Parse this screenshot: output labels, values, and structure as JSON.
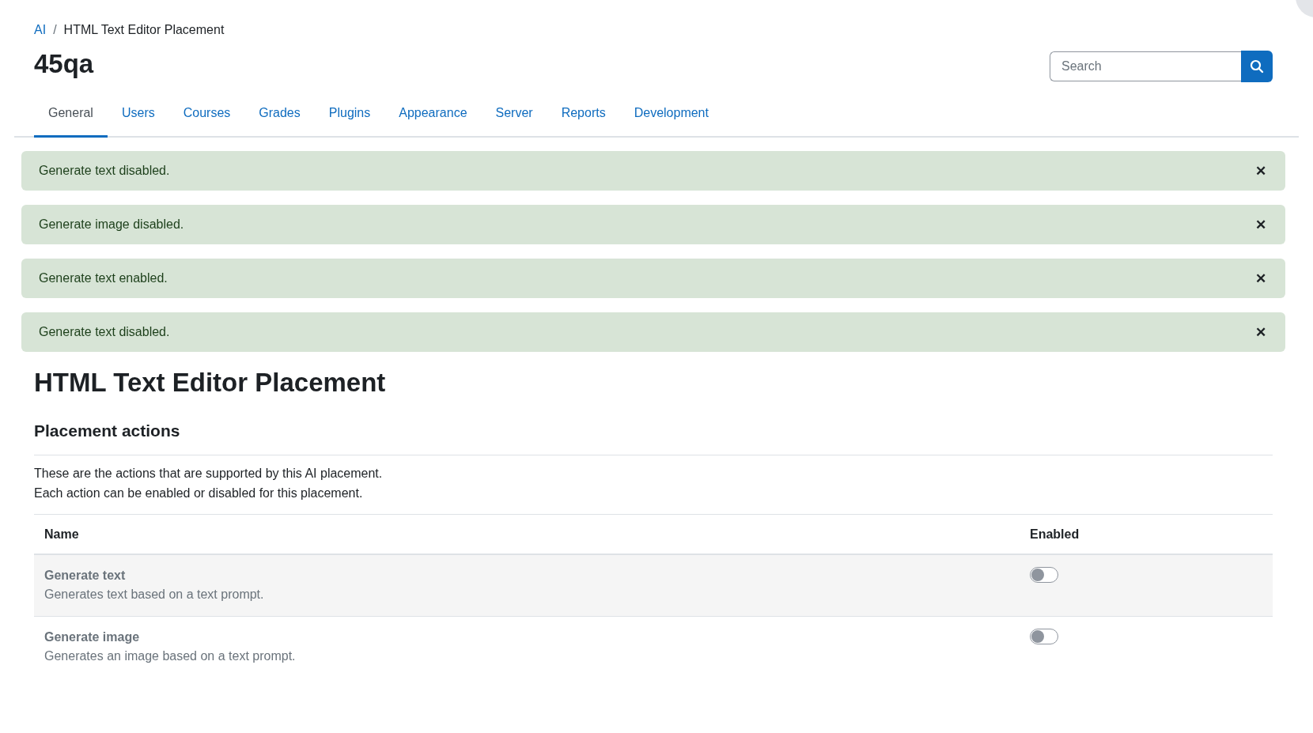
{
  "breadcrumb": [
    {
      "label": "AI",
      "link": true
    },
    {
      "label": "HTML Text Editor Placement",
      "link": false
    }
  ],
  "breadcrumb_separator": "/",
  "site_title": "45qa",
  "search": {
    "placeholder": "Search"
  },
  "tabs": [
    {
      "label": "General",
      "selected": true
    },
    {
      "label": "Users",
      "selected": false
    },
    {
      "label": "Courses",
      "selected": false
    },
    {
      "label": "Grades",
      "selected": false
    },
    {
      "label": "Plugins",
      "selected": false
    },
    {
      "label": "Appearance",
      "selected": false
    },
    {
      "label": "Server",
      "selected": false
    },
    {
      "label": "Reports",
      "selected": false
    },
    {
      "label": "Development",
      "selected": false
    }
  ],
  "alerts": [
    {
      "message": "Generate text disabled.",
      "close": "✕"
    },
    {
      "message": "Generate image disabled.",
      "close": "✕"
    },
    {
      "message": "Generate text enabled.",
      "close": "✕"
    },
    {
      "message": "Generate text disabled.",
      "close": "✕"
    }
  ],
  "heading": "HTML Text Editor Placement",
  "section_title": "Placement actions",
  "description": [
    "These are the actions that are supported by this AI placement.",
    "Each action can be enabled or disabled for this placement."
  ],
  "table": {
    "columns": [
      "Name",
      "Enabled"
    ],
    "rows": [
      {
        "name": "Generate text",
        "description": "Generates text based on a text prompt.",
        "on": false
      },
      {
        "name": "Generate image",
        "description": "Generates an image based on a text prompt.",
        "on": false
      }
    ]
  }
}
